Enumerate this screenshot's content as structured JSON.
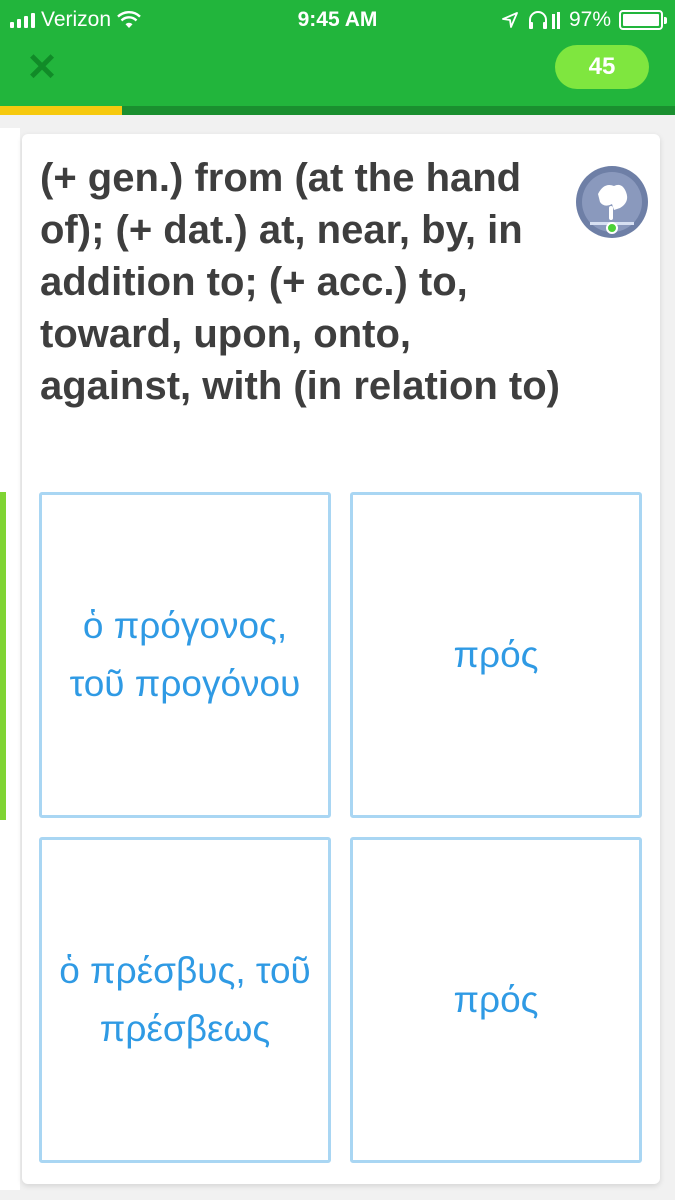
{
  "status": {
    "carrier": "Verizon",
    "time": "9:45 AM",
    "battery": "97%"
  },
  "header": {
    "close_symbol": "✕",
    "score": "45",
    "progress_fraction": 0.18
  },
  "question": {
    "prompt": "(+ gen.) from (at the hand of); (+ dat.) at, near, by, in addition to; (+ acc.) to, toward, upon, onto, against, with (in relation to)"
  },
  "choices": [
    {
      "label": "ὁ πρόγονος, τοῦ προγόνου"
    },
    {
      "label": "πρός"
    },
    {
      "label": "ὁ πρέσβυς, τοῦ πρέσβεως"
    },
    {
      "label": "πρός"
    }
  ],
  "icons": {
    "hint": "hand-hint-icon",
    "close": "close-icon",
    "wifi": "wifi-icon",
    "location": "location-arrow-icon",
    "headphones": "headphones-icon"
  },
  "colors": {
    "header_green": "#22b53c",
    "progress_yellow": "#f6c90e",
    "score_green": "#7fe63f",
    "choice_text_blue": "#2f9ae4",
    "choice_border": "#a9d6f3"
  }
}
